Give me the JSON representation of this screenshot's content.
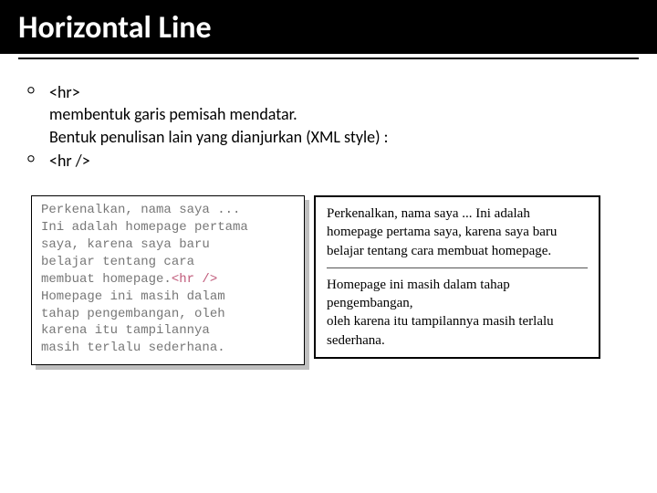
{
  "title": "Horizontal Line",
  "bullets": {
    "b1": "<hr>",
    "b1_desc1": "membentuk garis pemisah mendatar.",
    "b1_desc2": "Bentuk penulisan lain yang dianjurkan (XML style) :",
    "b2": "<hr />"
  },
  "codebox": {
    "l1": "Perkenalkan, nama saya ...",
    "l2": "Ini adalah homepage pertama",
    "l3": "saya, karena saya baru",
    "l4": "belajar tentang cara",
    "l5a": "membuat homepage.",
    "l5tag": "<hr />",
    "l6": "Homepage ini masih dalam",
    "l7": "tahap pengembangan, oleh",
    "l8": "karena itu tampilannya",
    "l9": "masih terlalu sederhana."
  },
  "renderbox": {
    "p1": "Perkenalkan, nama saya ... Ini adalah homepage pertama saya, karena saya baru belajar tentang cara membuat homepage.",
    "p2a": "Homepage ini masih dalam tahap pengembangan,",
    "p2b": "oleh karena itu tampilannya masih terlalu sederhana."
  }
}
